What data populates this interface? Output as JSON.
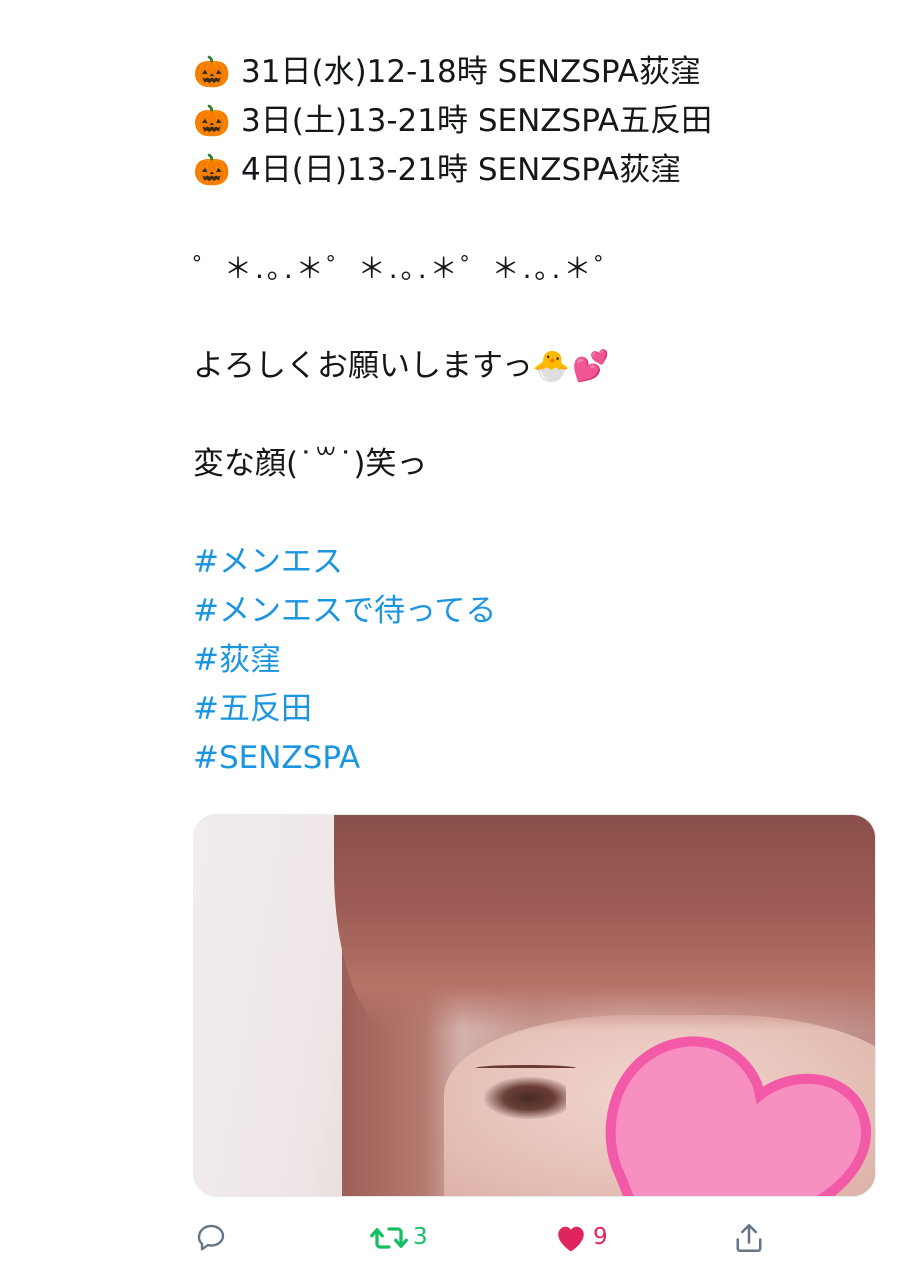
{
  "tweet": {
    "schedule": [
      {
        "icon": "jack-o-lantern-icon",
        "emoji": "🎃",
        "text": "31日(水)12-18時 SENZSPA荻窪"
      },
      {
        "icon": "jack-o-lantern-icon",
        "emoji": "🎃",
        "text": "3日(土)13-21時 SENZSPA五反田"
      },
      {
        "icon": "jack-o-lantern-icon",
        "emoji": "🎃",
        "text": "4日(日)13-21時 SENZSPA荻窪"
      }
    ],
    "sparkle_line": "゜＊.｡.＊゜＊.｡.＊゜＊.｡.＊゜",
    "greeting": "よろしくお願いしますっ",
    "greeting_emojis": [
      "🐣",
      "💕"
    ],
    "face_line": "変な顔(˙꒳˙)笑っ",
    "hashtags": [
      "#メンエス",
      "#メンエスで待ってる",
      "#荻窪",
      "#五反田",
      "#SENZSPA"
    ]
  },
  "media": {
    "icon": "photo"
  },
  "actions": {
    "reply": {
      "icon": "reply-icon",
      "count": ""
    },
    "retweet": {
      "icon": "retweet-icon",
      "count": "3"
    },
    "like": {
      "icon": "heart-icon",
      "count": "9"
    },
    "share": {
      "icon": "share-icon",
      "count": ""
    }
  },
  "colors": {
    "text": "#14171a",
    "hashtag": "#1b95e0",
    "retweet": "#17bf63",
    "like": "#e0245e",
    "icon_gray": "#657786"
  }
}
